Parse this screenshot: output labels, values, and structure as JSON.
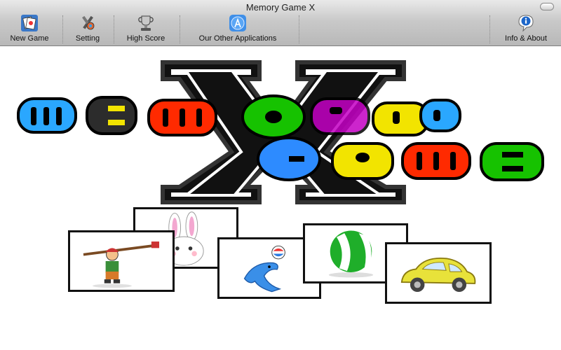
{
  "window": {
    "title": "Memory Game X"
  },
  "toolbar": {
    "new_game": "New Game",
    "setting": "Setting",
    "high_score": "High Score",
    "other_apps": "Our Other Applications",
    "info_about": "Info & About"
  },
  "icons": {
    "new_game": "cards-icon",
    "setting": "tools-icon",
    "high_score": "trophy-icon",
    "other_apps": "app-store-icon",
    "info_about": "info-bubble-icon"
  },
  "logo": {
    "letters_top": [
      "M",
      "E",
      "M",
      "O",
      "R",
      "Y"
    ],
    "letters_bottom": [
      "G",
      "A",
      "M",
      "E"
    ],
    "big_letter": "X",
    "colors_top": [
      "#2aa7ff",
      "#111111",
      "#f2e400",
      "#ff2a00",
      "#16c200",
      "#c400c4",
      "#ffe100",
      "#2aa7ff"
    ],
    "colors_bottom": [
      "#2d8bff",
      "#f2e400",
      "#ff2a00",
      "#16c200"
    ]
  },
  "cards": [
    {
      "name": "kid-painter-card"
    },
    {
      "name": "bunny-card"
    },
    {
      "name": "dolphin-card"
    },
    {
      "name": "beach-ball-card"
    },
    {
      "name": "toy-car-card"
    }
  ]
}
